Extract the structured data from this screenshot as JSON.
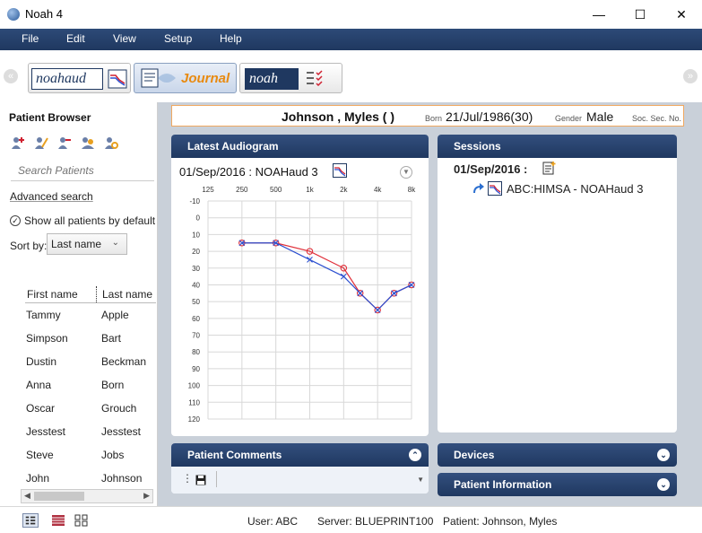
{
  "window": {
    "title": "Noah 4"
  },
  "menu": {
    "items": [
      "File",
      "Edit",
      "View",
      "Setup",
      "Help"
    ]
  },
  "modules": [
    {
      "label": "noahaud"
    },
    {
      "label": "Journal"
    },
    {
      "label": "noah"
    }
  ],
  "patient": {
    "last_name": "Johnson",
    "first_name": "Myles",
    "name_display": "Johnson ,  Myles  (  )",
    "born_label": "Born",
    "born": "21/Jul/1986(30)",
    "gender_label": "Gender",
    "gender": "Male",
    "ssn_label": "Soc. Sec. No."
  },
  "sidebar": {
    "title": "Patient Browser",
    "search_placeholder": "Search Patients",
    "advanced_search": "Advanced search",
    "show_all": "Show all patients by default",
    "sort_label": "Sort by:",
    "sort_value": "Last name",
    "columns": [
      "First name",
      "Last name"
    ],
    "rows": [
      [
        "Tammy",
        "Apple"
      ],
      [
        "Simpson",
        "Bart"
      ],
      [
        "Dustin",
        "Beckman"
      ],
      [
        "Anna",
        "Born"
      ],
      [
        "Oscar",
        "Grouch"
      ],
      [
        "Jesstest",
        "Jesstest"
      ],
      [
        "Steve",
        "Jobs"
      ],
      [
        "John",
        "Johnson"
      ]
    ]
  },
  "audiogram": {
    "panel_title": "Latest Audiogram",
    "date_label": "01/Sep/2016 : NOAHaud 3"
  },
  "chart_data": {
    "type": "line",
    "x": [
      125,
      250,
      500,
      1000,
      2000,
      4000,
      8000
    ],
    "x_tick_labels": [
      "125",
      "250",
      "500",
      "1k",
      "2k",
      "4k",
      "8k"
    ],
    "y_tick_labels": [
      "-10",
      "0",
      "10",
      "20",
      "30",
      "40",
      "50",
      "60",
      "70",
      "80",
      "90",
      "100",
      "110",
      "120"
    ],
    "ylim": [
      -10,
      120
    ],
    "y_inverted": true,
    "grid": true,
    "series": [
      {
        "marker": "circle",
        "color": "#e0303a",
        "points": [
          [
            250,
            15
          ],
          [
            500,
            15
          ],
          [
            1000,
            20
          ],
          [
            2000,
            30
          ],
          [
            2800,
            45
          ],
          [
            4000,
            55
          ],
          [
            5600,
            45
          ],
          [
            8000,
            40
          ]
        ]
      },
      {
        "marker": "x",
        "color": "#2b4fd0",
        "points": [
          [
            250,
            15
          ],
          [
            500,
            15
          ],
          [
            1000,
            25
          ],
          [
            2000,
            35
          ],
          [
            2800,
            45
          ],
          [
            4000,
            55
          ],
          [
            5600,
            45
          ],
          [
            8000,
            40
          ]
        ]
      }
    ]
  },
  "sessions": {
    "panel_title": "Sessions",
    "date": "01/Sep/2016 :",
    "entry": "ABC:HIMSA  - NOAHaud 3"
  },
  "comments": {
    "panel_title": "Patient Comments"
  },
  "devices": {
    "panel_title": "Devices"
  },
  "patient_info": {
    "panel_title": "Patient Information"
  },
  "status": {
    "user": "User: ABC",
    "server": "Server: BLUEPRINT100",
    "patient": "Patient: Johnson, Myles"
  }
}
